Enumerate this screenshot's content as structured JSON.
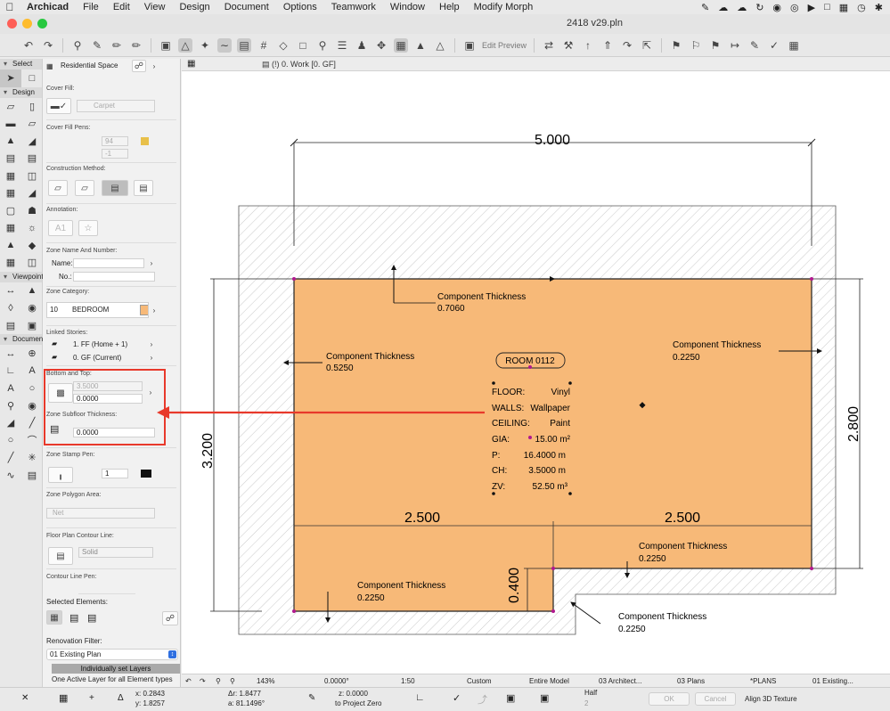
{
  "menubar": {
    "app": "Archicad",
    "items": [
      "File",
      "Edit",
      "View",
      "Design",
      "Document",
      "Options",
      "Teamwork",
      "Window",
      "Help",
      "Modify Morph"
    ]
  },
  "titlebar": {
    "document": "2418 v29.pln"
  },
  "toolbar": {
    "edit_preview": "Edit Preview"
  },
  "toolbox": {
    "select": "Select",
    "design": "Design",
    "viewpoint": "Viewpoint",
    "document": "Documen"
  },
  "infobox": {
    "zone_type": "Residential Space",
    "cover_fill_label": "Cover Fill:",
    "cover_fill_value": "Carpet",
    "cover_fill_pens_label": "Cover Fill Pens:",
    "pen1": "94",
    "pen2": "-1",
    "construction_method_label": "Construction Method:",
    "annotation_label": "Annotation:",
    "annotation_value": "A1",
    "zone_name_number_label": "Zone Name And Number:",
    "name_label": "Name:",
    "no_label": "No.:",
    "zone_category_label": "Zone Category:",
    "category_code": "10",
    "category_name": "BEDROOM",
    "linked_stories_label": "Linked Stories:",
    "story_top": "1. FF (Home + 1)",
    "story_bottom": "0. GF (Current)",
    "bottom_top_label": "Bottom and Top:",
    "height_value": "3.5000",
    "offset_value": "0.0000",
    "subfloor_label": "Zone Subfloor Thickness:",
    "subfloor_value": "0.0000",
    "stamp_pen_label": "Zone Stamp Pen:",
    "stamp_pen_value": "1",
    "polygon_area_label": "Zone Polygon Area:",
    "polygon_area_value": "Net",
    "floor_plan_contour_label": "Floor Plan Contour Line:",
    "contour_value": "Solid",
    "contour_pen_label": "Contour Line Pen:",
    "selected_elements_label": "Selected Elements:",
    "renovation_filter_label": "Renovation Filter:",
    "renovation_filter_value": "01 Existing Plan",
    "layer_button": "Individually set Layers",
    "layer_info": "One Active Layer for all Element types"
  },
  "tab": {
    "label": "(!) 0. Work [0. GF]"
  },
  "drawing": {
    "dim_top": "5.000",
    "dim_right": "2.800",
    "dim_left": "3.200",
    "dim_mid_left": "2.500",
    "dim_mid_right": "2.500",
    "dim_step": "0.400",
    "ct_top_label": "Component Thickness",
    "ct_top_value": "0.7060",
    "ct_left_label": "Component Thickness",
    "ct_left_value": "0.5250",
    "ct_right_label": "Component Thickness",
    "ct_right_value": "0.2250",
    "ct_bottom_left_label": "Component Thickness",
    "ct_bottom_left_value": "0.2250",
    "ct_bottom_right_label": "Component Thickness",
    "ct_bottom_right_value": "0.2250",
    "ct_outer_label": "Component Thickness",
    "ct_outer_value": "0.2250",
    "room_name": "ROOM 0112",
    "floor_label": "FLOOR:",
    "floor_value": "Vinyl",
    "walls_label": "WALLS:",
    "walls_value": "Wallpaper",
    "ceiling_label": "CEILING:",
    "ceiling_value": "Paint",
    "gia_label": "GIA:",
    "gia_value": "15.00 m²",
    "p_label": "P:",
    "p_value": "16.4000 m",
    "ch_label": "CH:",
    "ch_value": "3.5000 m",
    "zv_label": "ZV:",
    "zv_value": "52.50 m³",
    "zone_color": "#f7b978",
    "highlight_color": "#e8392b"
  },
  "status1": {
    "zoom": "143%",
    "angle": "0.0000°",
    "scale": "1:50",
    "custom": "Custom",
    "model": "Entire Model",
    "architect": "03 Architect...",
    "plans": "03 Plans",
    "plans2": "*PLANS",
    "existing": "01 Existing..."
  },
  "status2": {
    "x": "x: 0.2843",
    "y": "y: 1.8257",
    "dr": "Δr: 1.8477",
    "da": "a: 81.1496°",
    "z": "z: 0.0000",
    "proj": "to Project Zero",
    "half": "Half",
    "half_val": "2",
    "ok": "OK",
    "cancel": "Cancel",
    "align": "Align 3D Texture"
  }
}
